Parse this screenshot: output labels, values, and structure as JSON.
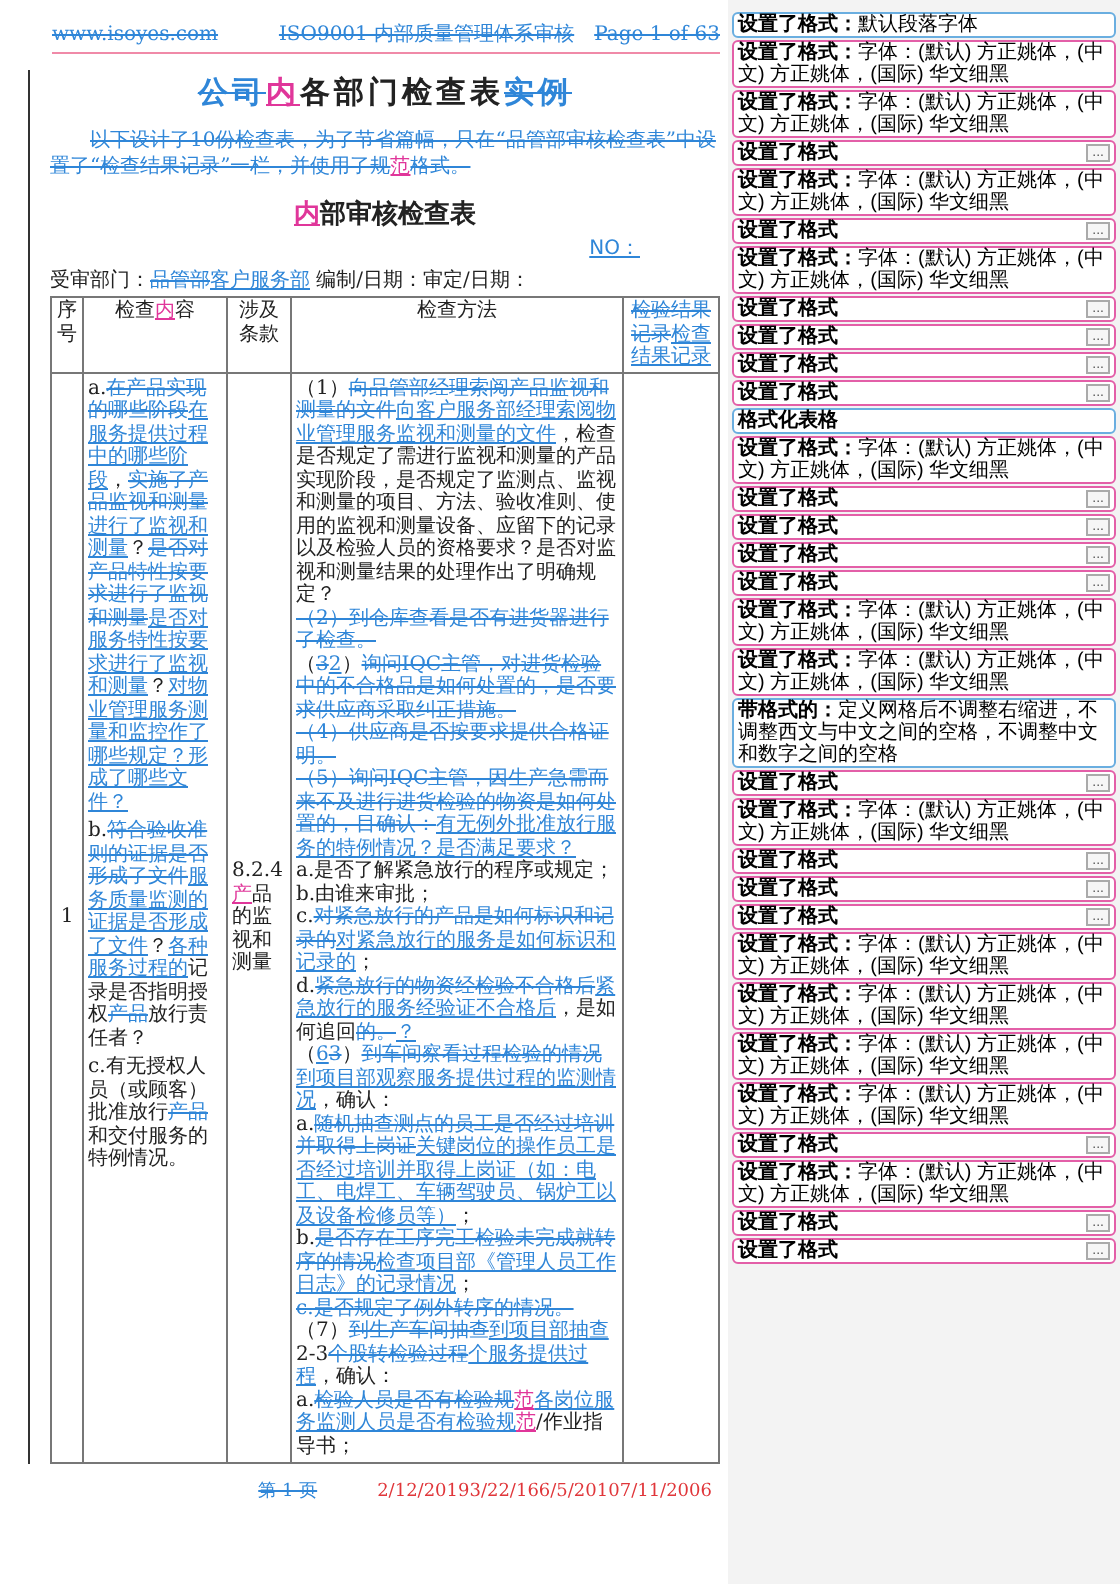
{
  "header": [
    {
      "text": "www.isoyes.com",
      "kind": "delete"
    },
    {
      "text": "ISO9001 内部质量管理体系审核",
      "kind": "delete"
    },
    {
      "text": "Page 1 of 63",
      "kind": "delete"
    }
  ],
  "title": [
    {
      "text": "公司",
      "kind": "delete"
    },
    {
      "text": "内",
      "kind": "alt"
    },
    {
      "text": "各部门检查表",
      "kind": "none"
    },
    {
      "text": "实例",
      "kind": "delete"
    }
  ],
  "intro": [
    {
      "text": "以下设计了10份检查表，为了节省篇幅，只在“品管部审核检查表”中设置了“检查结果记录”一栏，并使用了规",
      "kind": "delete"
    },
    {
      "text": "范",
      "kind": "alt"
    },
    {
      "text": "格式。",
      "kind": "delete"
    }
  ],
  "subtitle": [
    {
      "text": "内",
      "kind": "alt"
    },
    {
      "text": "部审核检查表",
      "kind": "none"
    }
  ],
  "number_label": [
    {
      "text": "NO：",
      "kind": "insert"
    }
  ],
  "meta": [
    {
      "text": "受审部门：",
      "kind": "none"
    },
    {
      "text": "品管部",
      "kind": "delete"
    },
    {
      "text": "客户服务部",
      "kind": "insert"
    },
    {
      "text": " 编制/日期：审定/日期：",
      "kind": "none"
    }
  ],
  "table": {
    "columns": [
      [
        {
          "text": "序号",
          "kind": "none"
        }
      ],
      [
        {
          "text": "检查",
          "kind": "none"
        },
        {
          "text": "内",
          "kind": "alt"
        },
        {
          "text": "容",
          "kind": "none"
        }
      ],
      [
        {
          "text": "涉及条款",
          "kind": "none"
        }
      ],
      [
        {
          "text": "检查方法",
          "kind": "none"
        }
      ],
      [
        {
          "text": "检验结果记录",
          "kind": "delete"
        },
        {
          "text": "检查结果记录",
          "kind": "insert"
        }
      ]
    ],
    "rows": [
      {
        "number": "1",
        "content": [
          [
            {
              "text": "a.",
              "kind": "none"
            },
            {
              "text": "在产品实现的哪些阶段",
              "kind": "delete"
            },
            {
              "text": "在服务提供过程中的哪些阶段",
              "kind": "insert"
            },
            {
              "text": "，",
              "kind": "none"
            },
            {
              "text": "实施了产品监视和测量",
              "kind": "delete"
            },
            {
              "text": "进行了监视和测量",
              "kind": "insert"
            },
            {
              "text": "？",
              "kind": "none"
            },
            {
              "text": "是否对产品特性按要求进行了监视和测量",
              "kind": "delete"
            },
            {
              "text": "是否对服务特性按要求进行了监视和测量",
              "kind": "insert"
            },
            {
              "text": "？",
              "kind": "none"
            },
            {
              "text": "对物业管理服务测量和监控作了哪些规定？形成了哪些文件？",
              "kind": "insert"
            }
          ],
          [
            {
              "text": "b.",
              "kind": "none"
            },
            {
              "text": "符合验收准则的证据是否形成了文件",
              "kind": "delete"
            },
            {
              "text": "服务质量监测的证据是否形成了文件",
              "kind": "insert"
            },
            {
              "text": "？",
              "kind": "none"
            },
            {
              "text": "各种服务过程的",
              "kind": "insert"
            },
            {
              "text": "记录是否指明授权",
              "kind": "none"
            },
            {
              "text": "产品",
              "kind": "delete"
            },
            {
              "text": "放行责任者？",
              "kind": "none"
            }
          ],
          [
            {
              "text": "c.有无授权人员（或顾客）批准放行",
              "kind": "none"
            },
            {
              "text": "产品",
              "kind": "delete"
            },
            {
              "text": "和交付服务的特例情况。",
              "kind": "none"
            }
          ]
        ],
        "clause": [
          {
            "text": "8.2.4 ",
            "kind": "none"
          },
          {
            "text": "产",
            "kind": "alt"
          },
          {
            "text": "品的监视和测量",
            "kind": "none"
          }
        ],
        "method": [
          [
            {
              "text": "（1）",
              "kind": "none"
            },
            {
              "text": "向品管部经理索阅产品监视和测量的文件",
              "kind": "delete"
            },
            {
              "text": "向客户服务部经理索阅物业管理服务监视和测量的文件",
              "kind": "insert"
            },
            {
              "text": "，检查是否规定了需进行监视和测量的产品实现阶段，是否规定了监测点、监视和测量的项目、方法、验收准则、使用的监视和测量设备、应留下的记录以及检验人员的资格要求？是否对监视和测量结果的处理作出了明确规定？",
              "kind": "none"
            }
          ],
          [
            {
              "text": "（2）到仓库查看是否有进货器进行了检查。",
              "kind": "delete"
            }
          ],
          [
            {
              "text": "（",
              "kind": "none"
            },
            {
              "text": "3",
              "kind": "delete"
            },
            {
              "text": "2",
              "kind": "insert"
            },
            {
              "text": "）",
              "kind": "none"
            },
            {
              "text": "询问IQC主管，对进货检验中的不合格品是如何处置的，是否要求供应商采取纠正措施。",
              "kind": "delete"
            }
          ],
          [
            {
              "text": "（4）供应商是否按要求提供合格证明。",
              "kind": "delete"
            }
          ],
          [
            {
              "text": "（5）询问IQC主管，因生产急需而来不及进行进货检验的物资是如何处置的，目确认：",
              "kind": "delete"
            },
            {
              "text": "有无例外批准放行服务的特例情况？是否满足要求？",
              "kind": "insert"
            }
          ],
          [
            {
              "text": "a.是否了解紧急放行的程序或规定；",
              "kind": "none"
            }
          ],
          [
            {
              "text": "b.由谁来审批；",
              "kind": "none"
            }
          ],
          [
            {
              "text": "c.",
              "kind": "none"
            },
            {
              "text": "对紧急放行的产品是如何标识和记录的",
              "kind": "delete"
            },
            {
              "text": "对紧急放行的服务是如何标识和记录的",
              "kind": "insert"
            },
            {
              "text": "；",
              "kind": "none"
            }
          ],
          [
            {
              "text": "d.",
              "kind": "none"
            },
            {
              "text": "紧急放行的物资经检验不合格后",
              "kind": "delete"
            },
            {
              "text": "紧急放行的服务经验证不合格后",
              "kind": "insert"
            },
            {
              "text": "，是如何追回",
              "kind": "none"
            },
            {
              "text": "的。",
              "kind": "delete"
            },
            {
              "text": "？",
              "kind": "insert"
            }
          ],
          [
            {
              "text": "（",
              "kind": "none"
            },
            {
              "text": "6",
              "kind": "insert"
            },
            {
              "text": "3",
              "kind": "delete"
            },
            {
              "text": "）",
              "kind": "none"
            },
            {
              "text": "到车间察看过程检验的情况",
              "kind": "delete"
            },
            {
              "text": "到项目部观察服务提供过程的监测情况",
              "kind": "insert"
            },
            {
              "text": "，确认：",
              "kind": "none"
            }
          ],
          [
            {
              "text": "a.",
              "kind": "none"
            },
            {
              "text": "随机抽查测点的员工是否经过培训并取得上岗证",
              "kind": "delete"
            },
            {
              "text": "关键岗位的操作员工是否经过培训并取得上岗证（如：电工、电焊工、车辆驾驶员、锅炉工以及设备检修员等）",
              "kind": "insert"
            },
            {
              "text": "；",
              "kind": "none"
            }
          ],
          [
            {
              "text": "b.",
              "kind": "none"
            },
            {
              "text": "是否存在工序完工检验未完成就转序的情况",
              "kind": "delete"
            },
            {
              "text": "检查项目部《管理人员工作日志》的记录情况",
              "kind": "insert"
            },
            {
              "text": "；",
              "kind": "none"
            }
          ],
          [
            {
              "text": "c.是否规定了例外转序的情况。",
              "kind": "delete"
            }
          ],
          [
            {
              "text": "（7）",
              "kind": "none"
            },
            {
              "text": "到生产车间抽查",
              "kind": "delete"
            },
            {
              "text": "到项目部抽查",
              "kind": "insert"
            },
            {
              "text": "2-3",
              "kind": "none"
            },
            {
              "text": "个股转检验过程",
              "kind": "delete"
            },
            {
              "text": "个服务提供过程",
              "kind": "insert"
            },
            {
              "text": "，确认：",
              "kind": "none"
            }
          ],
          [
            {
              "text": "a.",
              "kind": "none"
            },
            {
              "text": "检验人员是否有检验规",
              "kind": "delete"
            },
            {
              "text": "范",
              "kind": "alt"
            },
            {
              "text": "各岗位服务监测人员是否有检验规",
              "kind": "insert"
            },
            {
              "text": "范",
              "kind": "alt"
            },
            {
              "text": "/作业指导书；",
              "kind": "none"
            }
          ]
        ]
      }
    ]
  },
  "footer": [
    {
      "text": "第 1 页",
      "kind": "delete"
    },
    {
      "text": "2/12/20193/22/166/5/20107/11/2006",
      "kind": "field"
    }
  ],
  "balloons": [
    {
      "label": "设置了格式：",
      "detail": "默认段落字体",
      "color": "#6aaee0"
    },
    {
      "label": "设置了格式：",
      "detail": "字体：(默认) 方正姚体，(中文) 方正姚体，(国际) 华文细黑",
      "color": "#e35fa8"
    },
    {
      "label": "设置了格式：",
      "detail": "字体：(默认) 方正姚体，(中文) 方正姚体，(国际) 华文细黑",
      "color": "#e35fa8"
    },
    {
      "label": "设置了格式",
      "button": "...",
      "color": "#e35fa8"
    },
    {
      "label": "设置了格式：",
      "detail": "字体：(默认) 方正姚体，(中文) 方正姚体，(国际) 华文细黑",
      "color": "#e35fa8"
    },
    {
      "label": "设置了格式",
      "button": "...",
      "color": "#e35fa8"
    },
    {
      "label": "设置了格式：",
      "detail": "字体：(默认) 方正姚体，(中文) 方正姚体，(国际) 华文细黑",
      "color": "#e35fa8"
    },
    {
      "label": "设置了格式",
      "button": "...",
      "color": "#e35fa8"
    },
    {
      "label": "设置了格式",
      "button": "...",
      "color": "#e35fa8"
    },
    {
      "label": "设置了格式",
      "button": "...",
      "color": "#e35fa8"
    },
    {
      "label": "设置了格式",
      "button": "...",
      "color": "#e35fa8"
    },
    {
      "label": "格式化表格",
      "color": "#6aaee0"
    },
    {
      "label": "设置了格式：",
      "detail": "字体：(默认) 方正姚体，(中文) 方正姚体，(国际) 华文细黑",
      "color": "#e35fa8"
    },
    {
      "label": "设置了格式",
      "button": "...",
      "color": "#e35fa8"
    },
    {
      "label": "设置了格式",
      "button": "...",
      "color": "#e35fa8"
    },
    {
      "label": "设置了格式",
      "button": "...",
      "color": "#e35fa8"
    },
    {
      "label": "设置了格式",
      "button": "...",
      "color": "#e35fa8"
    },
    {
      "label": "设置了格式：",
      "detail": "字体：(默认) 方正姚体，(中文) 方正姚体，(国际) 华文细黑",
      "color": "#e35fa8"
    },
    {
      "label": "设置了格式：",
      "detail": "字体：(默认) 方正姚体，(中文) 方正姚体，(国际) 华文细黑",
      "color": "#e35fa8"
    },
    {
      "label": "带格式的：",
      "detail": "定义网格后不调整右缩进，不调整西文与中文之间的空格，不调整中文和数字之间的空格",
      "color": "#6aaee0"
    },
    {
      "label": "设置了格式",
      "button": "...",
      "color": "#e35fa8"
    },
    {
      "label": "设置了格式：",
      "detail": "字体：(默认) 方正姚体，(中文) 方正姚体，(国际) 华文细黑",
      "color": "#e35fa8"
    },
    {
      "label": "设置了格式",
      "button": "...",
      "color": "#e35fa8"
    },
    {
      "label": "设置了格式",
      "button": "...",
      "color": "#e35fa8"
    },
    {
      "label": "设置了格式",
      "button": "...",
      "color": "#e35fa8"
    },
    {
      "label": "设置了格式：",
      "detail": "字体：(默认) 方正姚体，(中文) 方正姚体，(国际) 华文细黑",
      "color": "#e35fa8"
    },
    {
      "label": "设置了格式：",
      "detail": "字体：(默认) 方正姚体，(中文) 方正姚体，(国际) 华文细黑",
      "color": "#e35fa8"
    },
    {
      "label": "设置了格式：",
      "detail": "字体：(默认) 方正姚体，(中文) 方正姚体，(国际) 华文细黑",
      "color": "#e35fa8"
    },
    {
      "label": "设置了格式：",
      "detail": "字体：(默认) 方正姚体，(中文) 方正姚体，(国际) 华文细黑",
      "color": "#e35fa8"
    },
    {
      "label": "设置了格式",
      "button": "...",
      "color": "#e35fa8"
    },
    {
      "label": "设置了格式：",
      "detail": "字体：(默认) 方正姚体，(中文) 方正姚体，(国际) 华文细黑",
      "color": "#e35fa8"
    },
    {
      "label": "设置了格式",
      "button": "...",
      "color": "#e35fa8"
    },
    {
      "label": "设置了格式",
      "button": "...",
      "color": "#e35fa8"
    }
  ]
}
